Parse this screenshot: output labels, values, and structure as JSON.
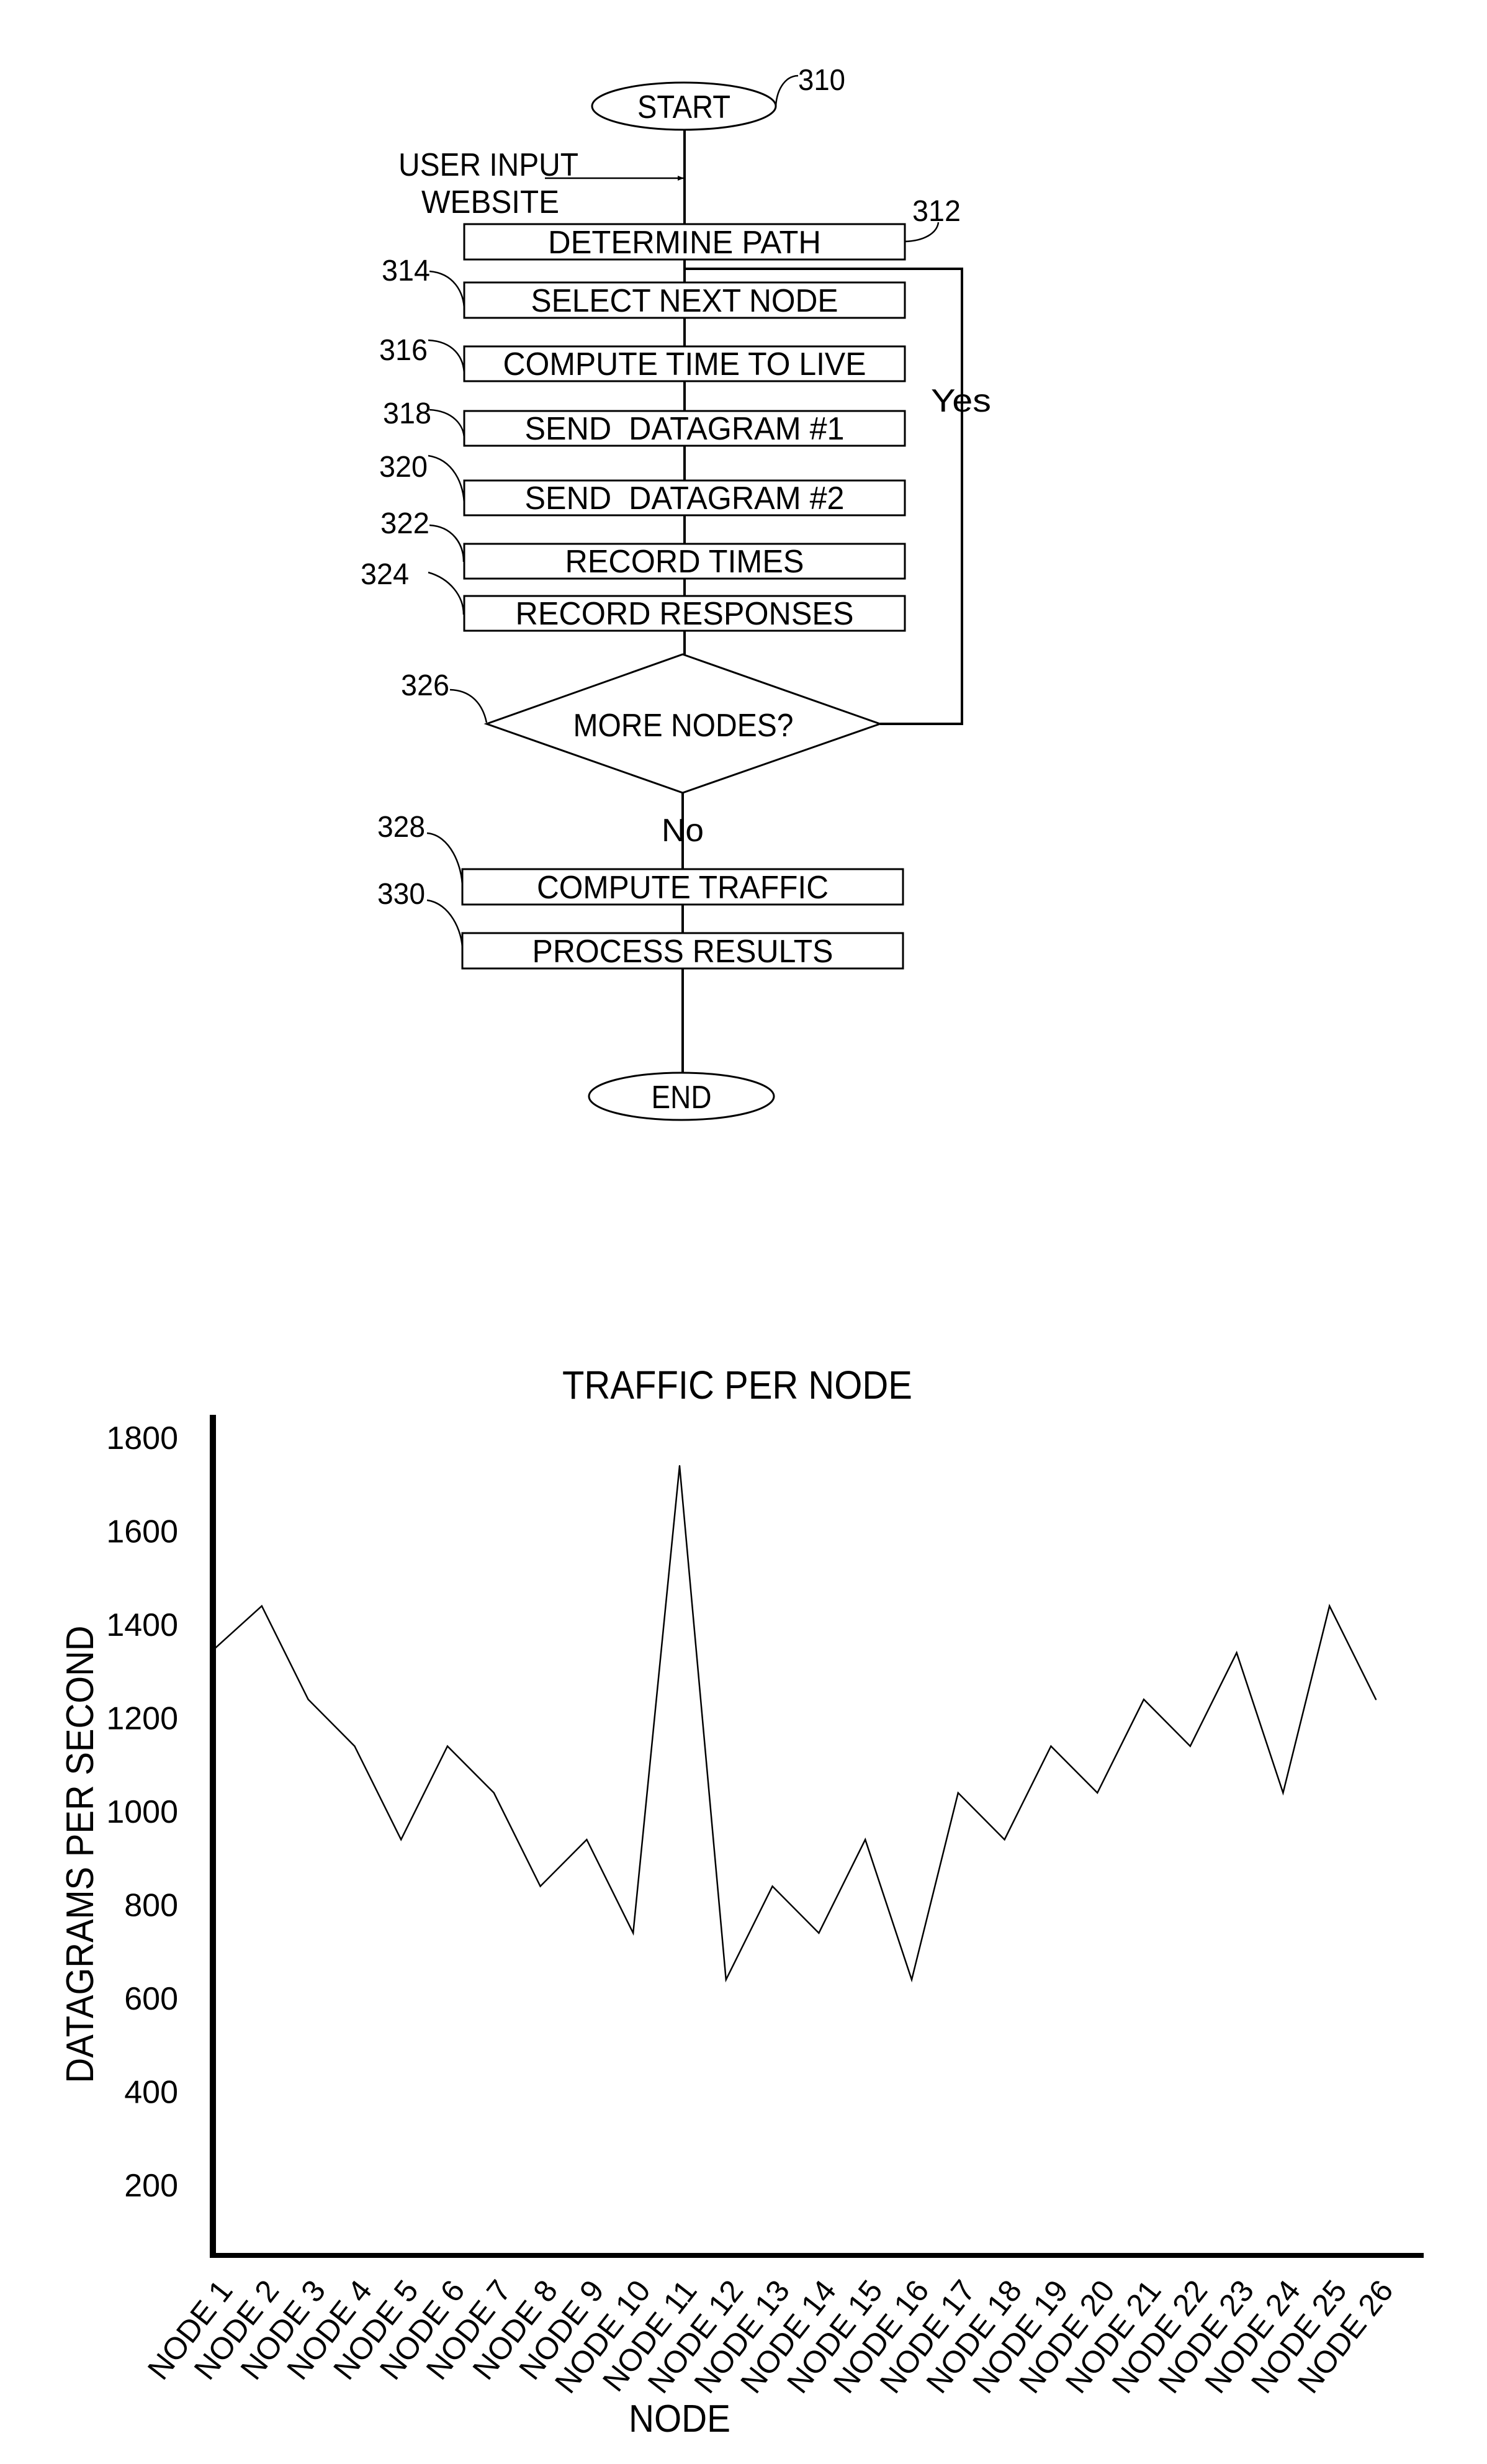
{
  "flowchart": {
    "start": {
      "label": "START",
      "ref": "310"
    },
    "input_label_line1": "USER INPUT",
    "input_label_line2": "WEBSITE",
    "steps": [
      {
        "ref": "312",
        "label": "DETERMINE PATH"
      },
      {
        "ref": "314",
        "label": "SELECT NEXT NODE"
      },
      {
        "ref": "316",
        "label": "COMPUTE TIME TO LIVE"
      },
      {
        "ref": "318",
        "label": "SEND  DATAGRAM #1"
      },
      {
        "ref": "320",
        "label": "SEND  DATAGRAM #2"
      },
      {
        "ref": "322",
        "label": "RECORD TIMES"
      },
      {
        "ref": "324",
        "label": "RECORD RESPONSES"
      }
    ],
    "decision": {
      "ref": "326",
      "label": "MORE NODES?",
      "yes_label": "Yes",
      "no_label": "No"
    },
    "post_steps": [
      {
        "ref": "328",
        "label": "COMPUTE TRAFFIC"
      },
      {
        "ref": "330",
        "label": "PROCESS RESULTS"
      }
    ],
    "end": {
      "label": "END"
    }
  },
  "chart_data": {
    "type": "line",
    "title": "TRAFFIC PER NODE",
    "xlabel": "NODE",
    "ylabel": "DATAGRAMS PER SECOND",
    "categories": [
      "NODE 1",
      "NODE 2",
      "NODE 3",
      "NODE 4",
      "NODE 5",
      "NODE 6",
      "NODE 7",
      "NODE 8",
      "NODE 9",
      "NODE 10",
      "NODE 11",
      "NODE 12",
      "NODE 13",
      "NODE 14",
      "NODE 15",
      "NODE 16",
      "NODE 17",
      "NODE 18",
      "NODE 19",
      "NODE 20",
      "NODE 21",
      "NODE 22",
      "NODE 23",
      "NODE 24",
      "NODE 25",
      "NODE 26"
    ],
    "series": [
      {
        "name": "Traffic",
        "values": [
          1350,
          1440,
          1240,
          1140,
          940,
          1140,
          1040,
          840,
          940,
          740,
          1740,
          640,
          840,
          740,
          940,
          640,
          1040,
          940,
          1140,
          1040,
          1240,
          1140,
          1340,
          1040,
          1440,
          1240
        ]
      }
    ],
    "yticks": [
      200,
      400,
      600,
      800,
      1000,
      1200,
      1400,
      1600,
      1800
    ],
    "ylim": [
      50,
      1850
    ],
    "grid": false,
    "legend": "none",
    "line_color": "#000000"
  }
}
